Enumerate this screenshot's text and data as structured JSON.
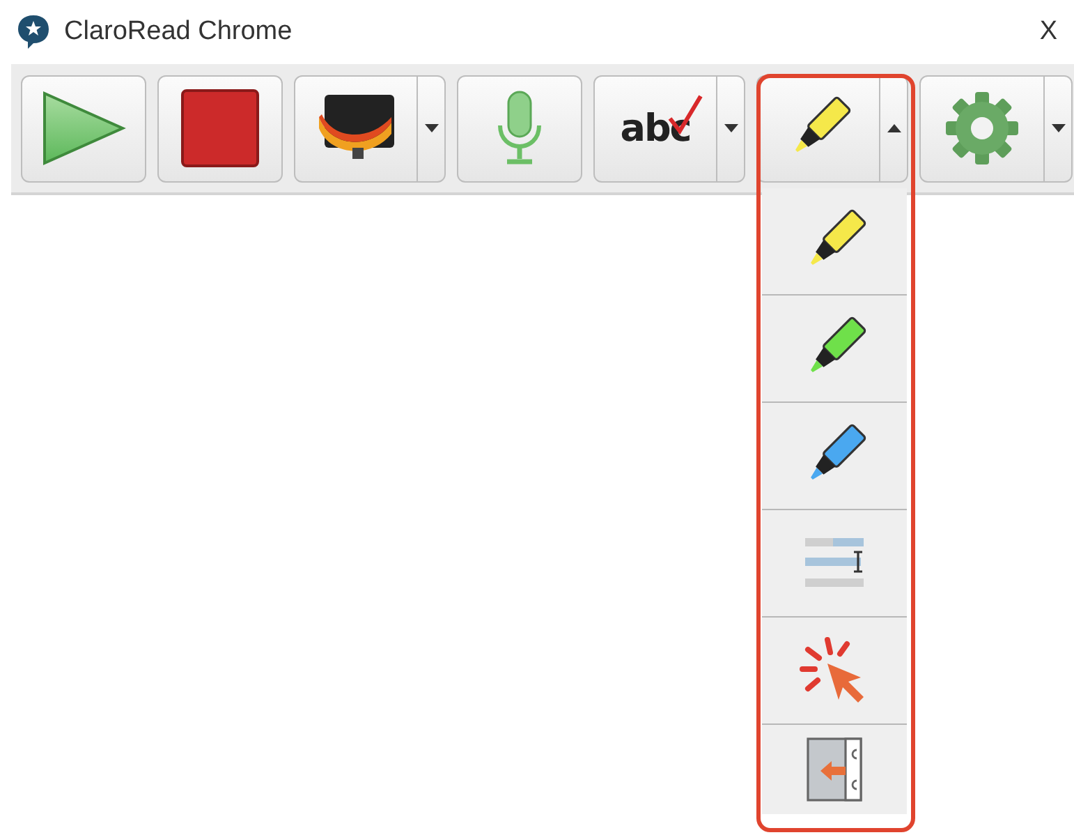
{
  "window": {
    "title": "ClaroRead Chrome",
    "close": "X"
  },
  "toolbar": [
    {
      "kind": "play"
    },
    {
      "kind": "stop"
    },
    {
      "kind": "screen",
      "dropdown": true,
      "expanded": false
    },
    {
      "kind": "mic"
    },
    {
      "kind": "spell",
      "label": "abc",
      "dropdown": true,
      "expanded": false
    },
    {
      "kind": "highlight",
      "dropdown": true,
      "expanded": true
    },
    {
      "kind": "settings",
      "dropdown": true,
      "expanded": false
    }
  ],
  "highlight_menu": [
    {
      "kind": "highlighter",
      "color": "#f5e84a"
    },
    {
      "kind": "highlighter",
      "color": "#6fe04a"
    },
    {
      "kind": "highlighter",
      "color": "#4aa8f0"
    },
    {
      "kind": "list"
    },
    {
      "kind": "click"
    },
    {
      "kind": "exit"
    }
  ]
}
